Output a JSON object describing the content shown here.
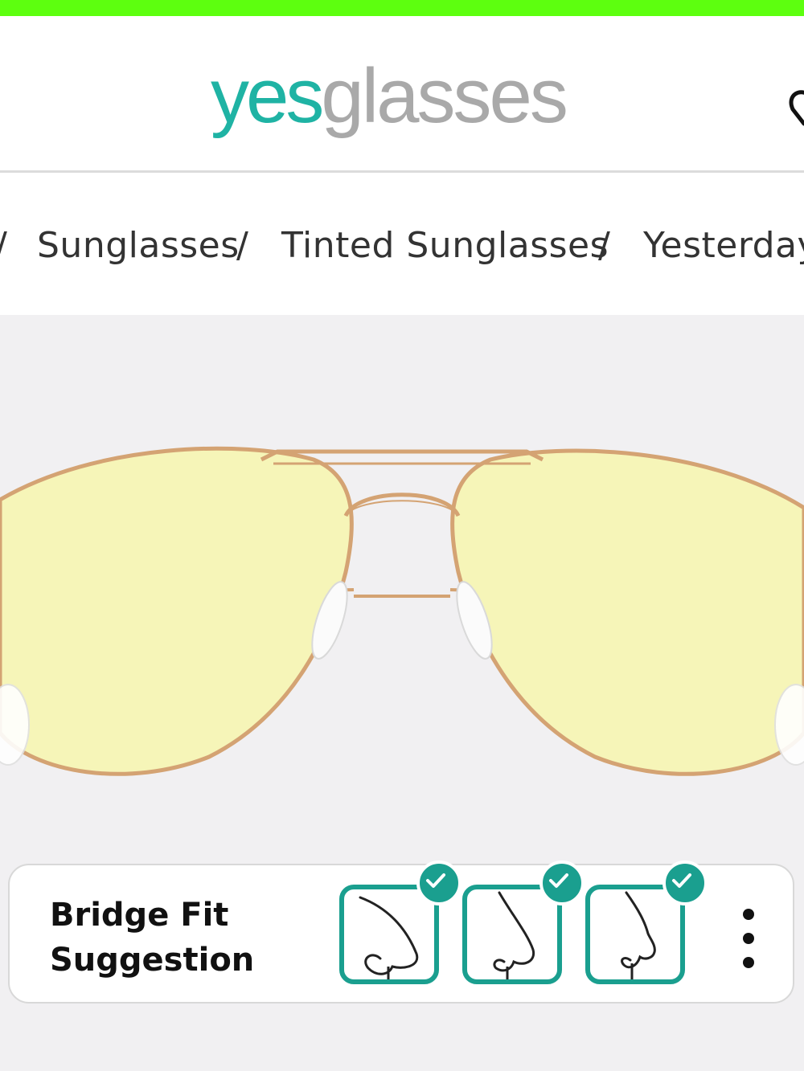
{
  "brand": {
    "logo_part1": "yes",
    "logo_part2": "glasses"
  },
  "breadcrumb": {
    "items": [
      "/",
      "Sunglasses",
      "/",
      "Tinted Sunglasses",
      "/",
      "Yesterday"
    ]
  },
  "bridge_fit": {
    "title_line1": "Bridge Fit",
    "title_line2": "Suggestion",
    "options": [
      {
        "icon": "low-bridge-nose-icon",
        "checked": true
      },
      {
        "icon": "medium-bridge-nose-icon",
        "checked": true
      },
      {
        "icon": "high-bridge-nose-icon",
        "checked": true
      }
    ]
  },
  "colors": {
    "top_bar": "#5dff0f",
    "brand_teal": "#1fb3a4",
    "brand_gray": "#a9a9a9",
    "check_teal": "#1a9f8f",
    "lens": "#f6f5b8",
    "frame": "#d4a373"
  },
  "icons": [
    "wishlist-heart-icon",
    "more-options-icon",
    "checkmark-icon"
  ]
}
